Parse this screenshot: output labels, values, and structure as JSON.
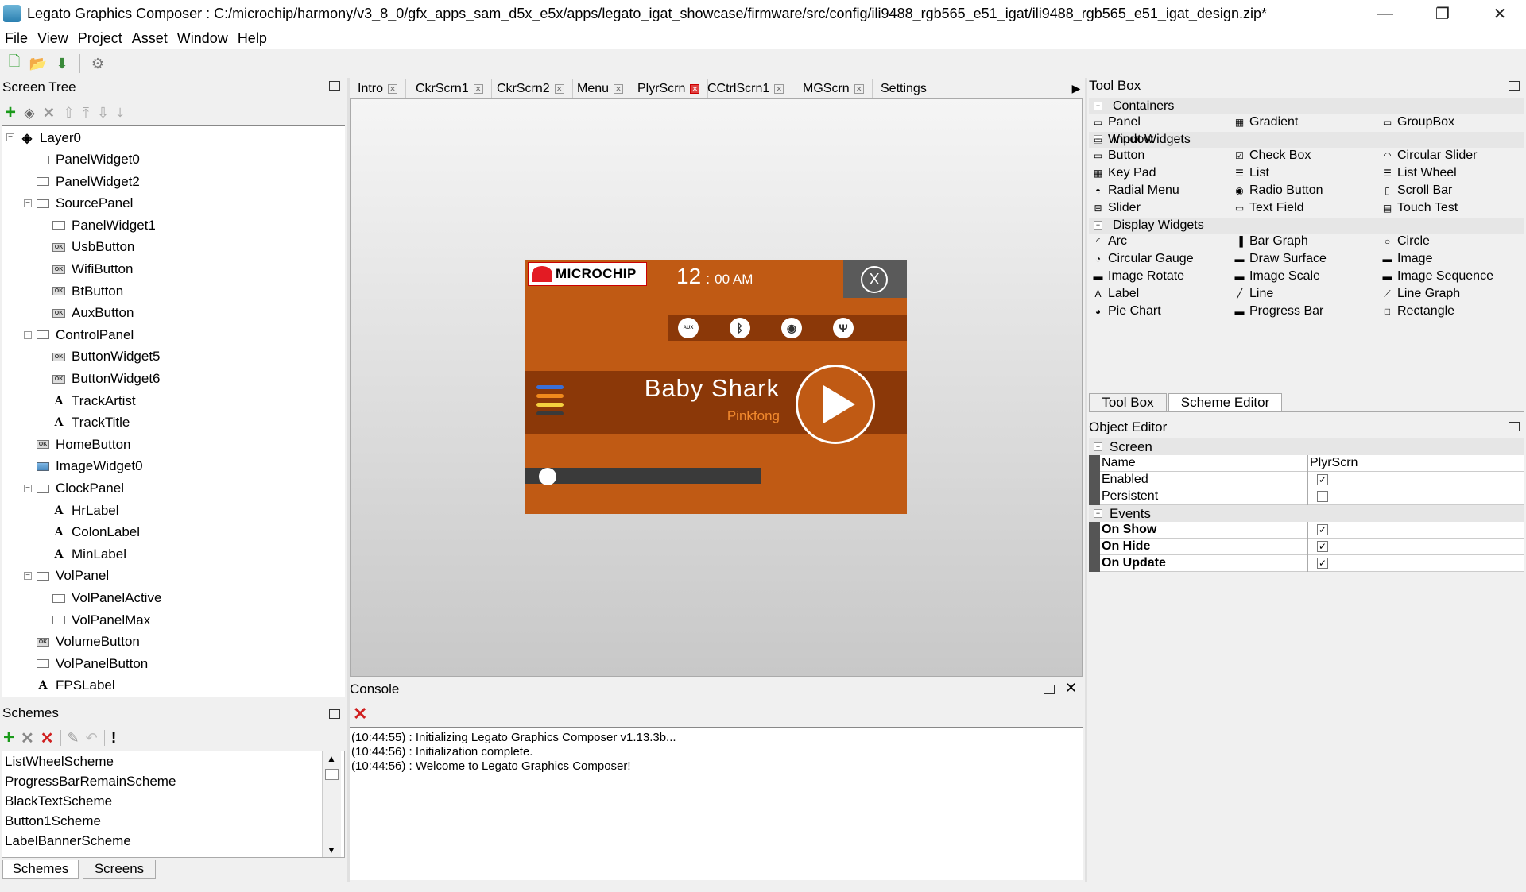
{
  "window": {
    "title": "Legato Graphics Composer : C:/microchip/harmony/v3_8_0/gfx_apps_sam_d5x_e5x/apps/legato_igat_showcase/firmware/src/config/ili9488_rgb565_e51_igat/ili9488_rgb565_e51_igat_design.zip*",
    "minimize": "—",
    "restore": "❐",
    "close": "✕"
  },
  "menu": [
    "File",
    "View",
    "Project",
    "Asset",
    "Window",
    "Help"
  ],
  "screen_tree": {
    "title": "Screen Tree",
    "root": "Layer0",
    "items": [
      {
        "label": "PanelWidget0",
        "icon": "panel"
      },
      {
        "label": "PanelWidget2",
        "icon": "panel"
      },
      {
        "label": "SourcePanel",
        "icon": "panel"
      },
      {
        "label": "PanelWidget1",
        "icon": "panel"
      },
      {
        "label": "UsbButton",
        "icon": "button"
      },
      {
        "label": "WifiButton",
        "icon": "button"
      },
      {
        "label": "BtButton",
        "icon": "button"
      },
      {
        "label": "AuxButton",
        "icon": "button"
      },
      {
        "label": "ControlPanel",
        "icon": "panel"
      },
      {
        "label": "ButtonWidget5",
        "icon": "button"
      },
      {
        "label": "ButtonWidget6",
        "icon": "button"
      },
      {
        "label": "TrackArtist",
        "icon": "label"
      },
      {
        "label": "TrackTitle",
        "icon": "label"
      },
      {
        "label": "HomeButton",
        "icon": "button"
      },
      {
        "label": "ImageWidget0",
        "icon": "image"
      },
      {
        "label": "ClockPanel",
        "icon": "panel"
      },
      {
        "label": "HrLabel",
        "icon": "label"
      },
      {
        "label": "ColonLabel",
        "icon": "label"
      },
      {
        "label": "MinLabel",
        "icon": "label"
      },
      {
        "label": "VolPanel",
        "icon": "panel"
      },
      {
        "label": "VolPanelActive",
        "icon": "panel"
      },
      {
        "label": "VolPanelMax",
        "icon": "panel"
      },
      {
        "label": "VolumeButton",
        "icon": "button"
      },
      {
        "label": "VolPanelButton",
        "icon": "panel"
      },
      {
        "label": "FPSLabel",
        "icon": "label"
      }
    ]
  },
  "tabs": [
    "Intro",
    "CkrScrn1",
    "CkrScrn2",
    "Menu",
    "PlyrScrn",
    "CCtrlScrn1",
    "MGScrn",
    "Settings"
  ],
  "active_tab": "PlyrScrn",
  "preview": {
    "logo": "MICROCHIP",
    "hour": "12",
    "colon": ":",
    "minute": "00 AM",
    "close": "X",
    "sources": [
      "AUX",
      "ᛒ",
      "◉",
      "Ψ"
    ],
    "track_title": "Baby  Shark",
    "track_artist": "Pinkfong",
    "menu_colors": [
      "#3a6fd8",
      "#f08a1c",
      "#f4d03f",
      "#3a3a3a"
    ],
    "progress": 0.05
  },
  "console": {
    "title": "Console",
    "lines": [
      "(10:44:55) : Initializing Legato Graphics Composer v1.13.3b...",
      "(10:44:56) : Initialization complete.",
      "(10:44:56) : Welcome to Legato Graphics Composer!"
    ]
  },
  "schemes": {
    "title": "Schemes",
    "items": [
      "ListWheelScheme",
      "ProgressBarRemainScheme",
      "BlackTextScheme",
      "Button1Scheme",
      "LabelBannerScheme"
    ],
    "tabs": [
      "Schemes",
      "Screens"
    ]
  },
  "toolbox": {
    "title": "Tool Box",
    "containers_label": "Containers",
    "containers": [
      "Panel",
      "Gradient",
      "GroupBox",
      "Window"
    ],
    "input_label": "Input Widgets",
    "input": [
      "Button",
      "Check Box",
      "Circular Slider",
      "Key Pad",
      "List",
      "List Wheel",
      "Radial Menu",
      "Radio Button",
      "Scroll Bar",
      "Slider",
      "Text Field",
      "Touch Test"
    ],
    "display_label": "Display Widgets",
    "display": [
      "Arc",
      "Bar Graph",
      "Circle",
      "Circular Gauge",
      "Draw Surface",
      "Image",
      "Image Rotate",
      "Image Scale",
      "Image Sequence",
      "Label",
      "Line",
      "Line Graph",
      "Pie Chart",
      "Progress Bar",
      "Rectangle"
    ],
    "tabs": [
      "Tool Box",
      "Scheme Editor"
    ]
  },
  "object_editor": {
    "title": "Object Editor",
    "screen_label": "Screen",
    "name_label": "Name",
    "name_value": "PlyrScrn",
    "enabled_label": "Enabled",
    "enabled": true,
    "persistent_label": "Persistent",
    "persistent": false,
    "events_label": "Events",
    "on_show_label": "On Show",
    "on_show": true,
    "on_hide_label": "On Hide",
    "on_hide": true,
    "on_update_label": "On Update",
    "on_update": true
  }
}
